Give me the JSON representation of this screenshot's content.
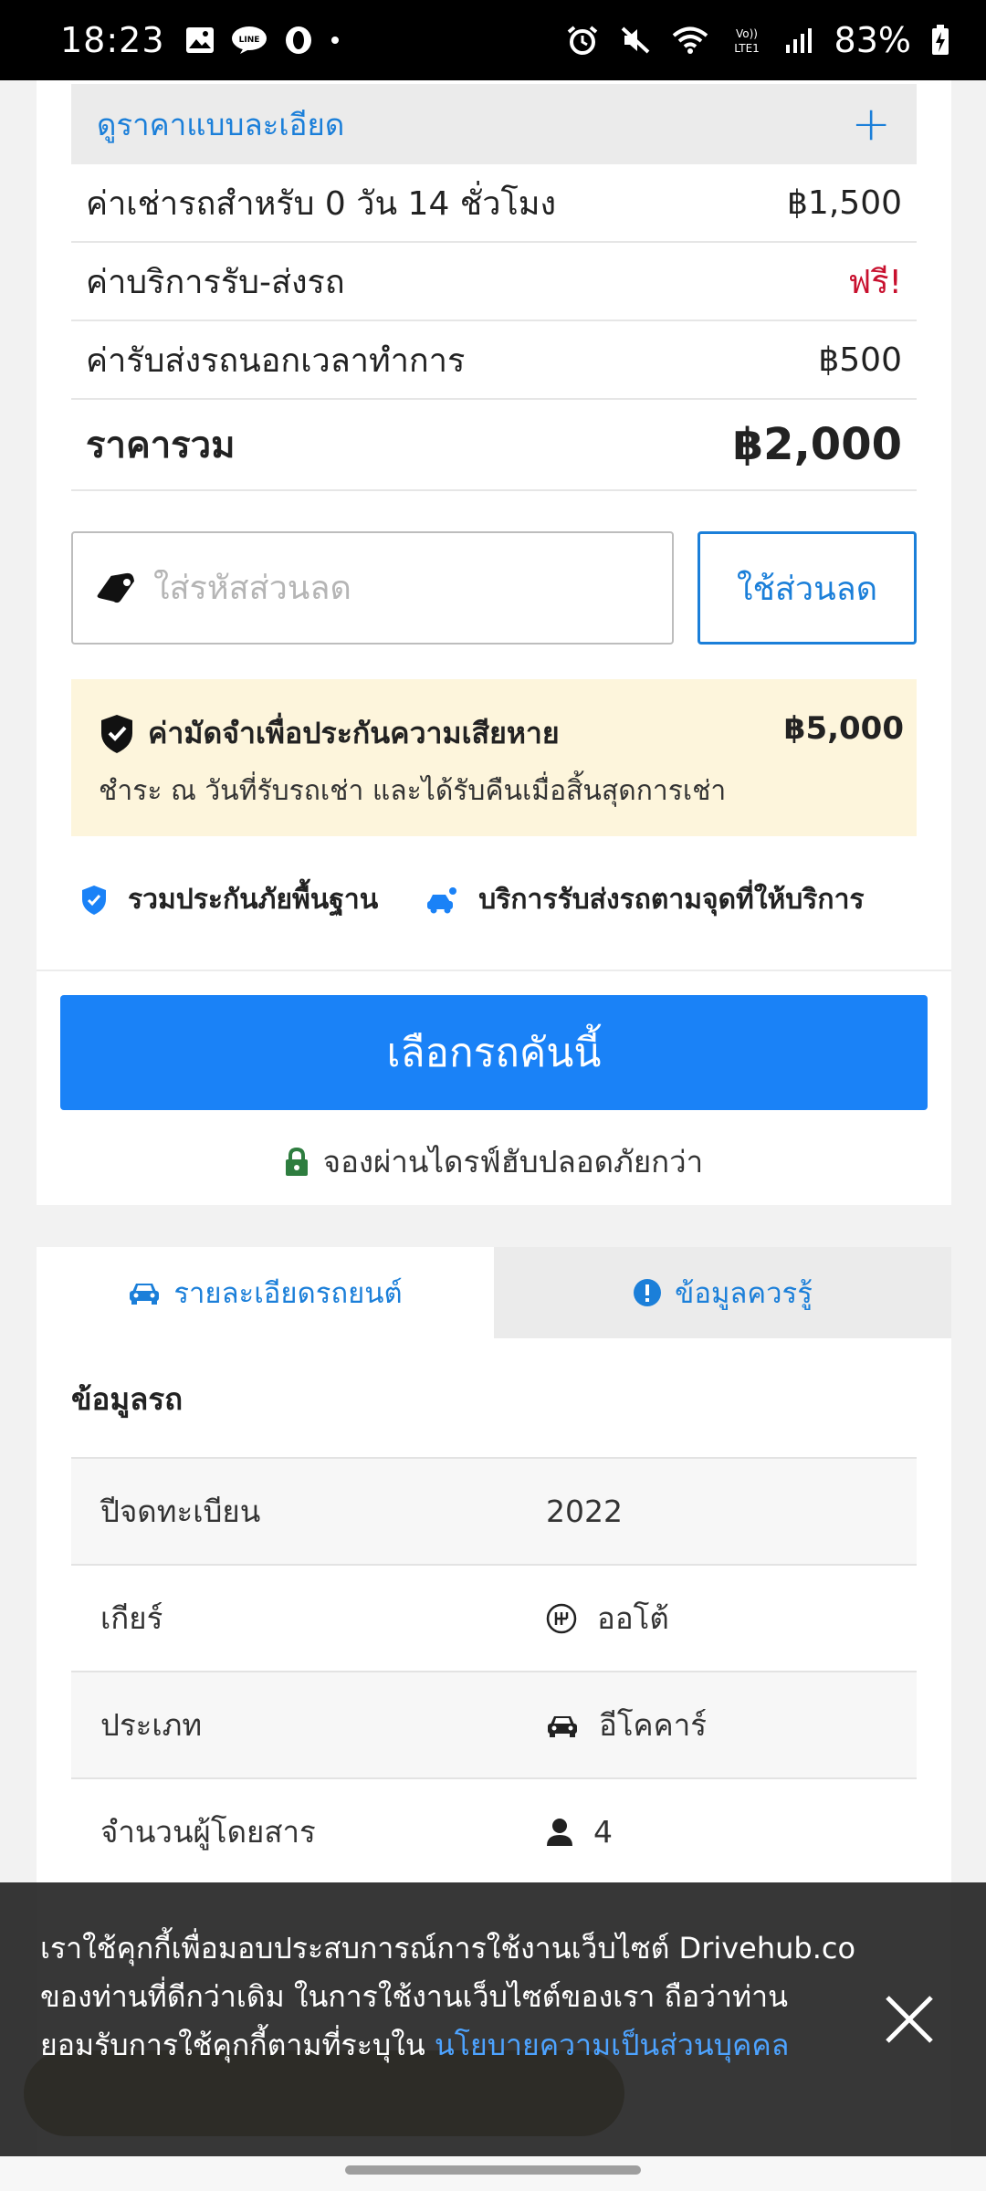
{
  "status_bar": {
    "time": "18:23",
    "battery": "83%"
  },
  "price_detail": {
    "header_label": "ดูราคาแบบละเอียด",
    "expand_symbol": "+",
    "rows": [
      {
        "name": "ค่าเช่ารถสำหรับ 0 วัน 14 ชั่วโมง",
        "value": "฿1,500"
      },
      {
        "name": "ค่าบริการรับ-ส่งรถ",
        "value": "ฟรี!"
      },
      {
        "name": "ค่ารับส่งรถนอกเวลาทำการ",
        "value": "฿500"
      }
    ],
    "total_label": "ราคารวม",
    "total_value": "฿2,000"
  },
  "coupon": {
    "placeholder": "ใส่รหัสส่วนลด",
    "button_label": "ใช้ส่วนลด"
  },
  "deposit": {
    "title": "ค่ามัดจำเพื่อประกันความเสียหาย",
    "amount": "฿5,000",
    "subtitle": "ชำระ ณ วันที่รับรถเช่า และได้รับคืนเมื่อสิ้นสุดการเช่า"
  },
  "features": {
    "insurance": "รวมประกันภัยพื้นฐาน",
    "delivery": "บริการรับส่งรถตามจุดที่ให้บริการ"
  },
  "cta": {
    "select_label": "เลือกรถคันนี้",
    "secure_note": "จองผ่านไดรฟ์ฮับปลอดภัยกว่า"
  },
  "tabs": {
    "car_details": "รายละเอียดรถยนต์",
    "need_to_know": "ข้อมูลควรรู้"
  },
  "car_info": {
    "title": "ข้อมูลรถ",
    "rows": [
      {
        "key": "ปีจดทะเบียน",
        "value": "2022"
      },
      {
        "key": "เกียร์",
        "value": "ออโต้"
      },
      {
        "key": "ประเภท",
        "value": "อีโคคาร์"
      },
      {
        "key": "จำนวนผู้โดยสาร",
        "value": "4"
      }
    ]
  },
  "cookie_banner": {
    "text": "เราใช้คุกกี้เพื่อมอบประสบการณ์การใช้งานเว็บไซต์ Drivehub.co ของท่านที่ดีกว่าเดิม ในการใช้งานเว็บไซต์ของเรา ถือว่าท่านยอมรับการใช้คุกกี้ตามที่ระบุใน ",
    "link": "นโยบายความเป็นส่วนบุคคล"
  },
  "colors": {
    "accent": "#1a82f7",
    "link": "#1b7fd9",
    "free": "#c8102e",
    "deposit_bg": "#fdf5dc"
  }
}
